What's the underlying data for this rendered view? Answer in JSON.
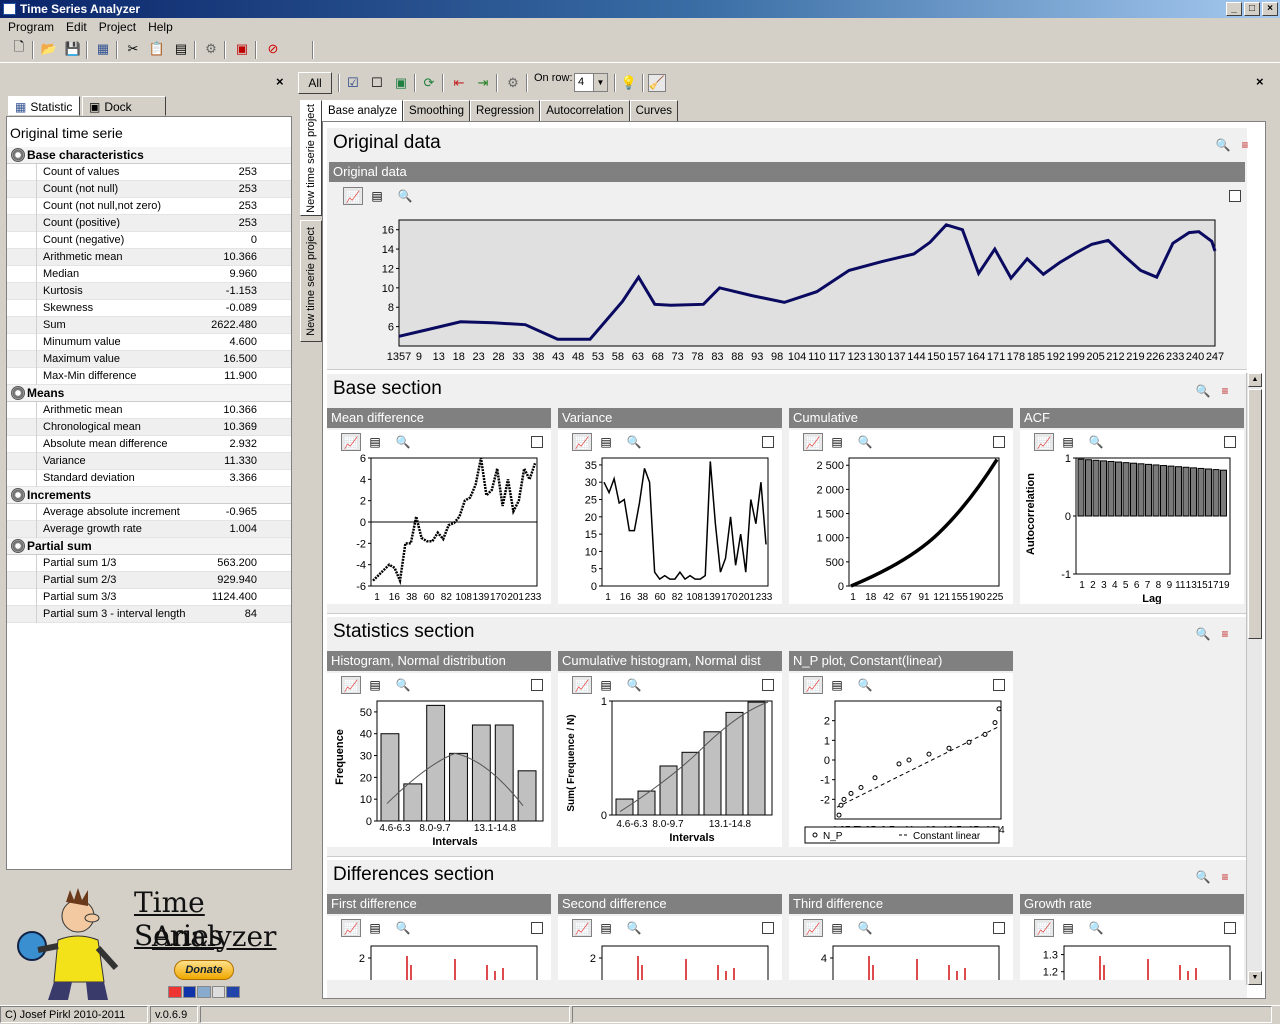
{
  "window": {
    "title": "Time Series Analyzer"
  },
  "menu": [
    "Program",
    "Edit",
    "Project",
    "Help"
  ],
  "toolbar2": {
    "all_label": "All",
    "on_row_label": "On row:",
    "on_row_value": "4"
  },
  "left_tabs": [
    "Statistic",
    "Dock stack"
  ],
  "statistic": {
    "title": "Original time serie",
    "sections": [
      {
        "name": "Base characteristics",
        "rows": [
          {
            "label": "Count of values",
            "value": "253"
          },
          {
            "label": "Count (not null)",
            "value": "253"
          },
          {
            "label": "Count (not null,not zero)",
            "value": "253"
          },
          {
            "label": "Count (positive)",
            "value": "253"
          },
          {
            "label": "Count (negative)",
            "value": "0"
          },
          {
            "label": "Arithmetic mean",
            "value": "10.366"
          },
          {
            "label": "Median",
            "value": "9.960"
          },
          {
            "label": "Kurtosis",
            "value": "-1.153"
          },
          {
            "label": "Skewness",
            "value": "-0.089"
          },
          {
            "label": "Sum",
            "value": "2622.480"
          },
          {
            "label": "Minumum value",
            "value": "4.600"
          },
          {
            "label": "Maximum value",
            "value": "16.500"
          },
          {
            "label": "Max-Min difference",
            "value": "11.900"
          }
        ]
      },
      {
        "name": "Means",
        "rows": [
          {
            "label": "Arithmetic mean",
            "value": "10.366"
          },
          {
            "label": "Chronological mean",
            "value": "10.369"
          },
          {
            "label": "Absolute mean difference",
            "value": "2.932"
          },
          {
            "label": "Variance",
            "value": "11.330"
          },
          {
            "label": "Standard deviation",
            "value": "3.366"
          }
        ]
      },
      {
        "name": "Increments",
        "rows": [
          {
            "label": "Average absolute increment",
            "value": "-0.965"
          },
          {
            "label": "Average growth rate",
            "value": "1.004"
          }
        ]
      },
      {
        "name": "Partial sum",
        "rows": [
          {
            "label": "Partial sum 1/3",
            "value": "563.200"
          },
          {
            "label": "Partial sum 2/3",
            "value": "929.940"
          },
          {
            "label": "Partial sum 3/3",
            "value": "1124.400"
          },
          {
            "label": "Partial sum 3 - interval length",
            "value": "84"
          }
        ]
      }
    ]
  },
  "logo": {
    "line1": "Time Series",
    "line2": "Analyzer",
    "donate": "Donate"
  },
  "vertical_tabs": [
    "New time serie project",
    "New time serie project"
  ],
  "analysis_tabs": [
    "Base analyze",
    "Smoothing",
    "Regression",
    "Autocorrelation",
    "Curves"
  ],
  "original": {
    "section_title": "Original data",
    "panel_title": "Original data"
  },
  "base_section": {
    "title": "Base section",
    "panels": [
      "Mean difference",
      "Variance",
      "Cumulative",
      "ACF"
    ]
  },
  "stats_section": {
    "title": "Statistics section",
    "panels": [
      "Histogram, Normal distribution",
      "Cumulative histogram, Normal dist",
      "N_P plot, Constant(linear)"
    ]
  },
  "diff_section": {
    "title": "Differences section",
    "panels": [
      "First difference",
      "Second difference",
      "Third difference",
      "Growth rate"
    ]
  },
  "chart_labels": {
    "acf_ylabel": "Autocorrelation",
    "acf_xlabel": "Lag",
    "hist_ylabel": "Frequence",
    "hist_xlabel": "Intervals",
    "cumhist_ylabel": "Sum( Frequence / N)",
    "cumhist_xlabel": "Intervals",
    "np_legend_1": "N_P",
    "np_legend_2": "Constant linear"
  },
  "chart_data": [
    {
      "type": "line",
      "title": "Original data",
      "ylim": [
        4,
        17
      ],
      "yticks": [
        6,
        8,
        10,
        12,
        14,
        16
      ],
      "xticklabels": [
        "1357",
        "9",
        "13",
        "18",
        "23",
        "28",
        "33",
        "38",
        "43",
        "48",
        "53",
        "58",
        "63",
        "68",
        "73",
        "78",
        "83",
        "88",
        "93",
        "98",
        "104",
        "110",
        "117",
        "123",
        "130",
        "137",
        "144",
        "150",
        "157",
        "164",
        "171",
        "178",
        "185",
        "192",
        "199",
        "205",
        "212",
        "219",
        "226",
        "233",
        "240",
        "247"
      ],
      "x": [
        1,
        10,
        20,
        30,
        40,
        50,
        60,
        70,
        75,
        80,
        85,
        95,
        100,
        110,
        120,
        130,
        140,
        150,
        160,
        165,
        170,
        175,
        180,
        185,
        190,
        195,
        200,
        205,
        210,
        215,
        220,
        225,
        230,
        235,
        240,
        245,
        248,
        252,
        253
      ],
      "y": [
        5,
        5.7,
        6.5,
        6.4,
        6.2,
        4.7,
        4.7,
        8.6,
        11.1,
        8.3,
        8.2,
        8.3,
        10,
        9.2,
        8.5,
        9.6,
        11.8,
        12.7,
        13.5,
        14.7,
        16.5,
        16,
        11.5,
        14,
        11,
        13,
        11.4,
        12.6,
        13.6,
        14.5,
        14.9,
        13.3,
        11.8,
        11.1,
        14.6,
        15.7,
        15.8,
        14.8,
        13.8
      ]
    },
    {
      "type": "line",
      "title": "Mean difference",
      "ylim": [
        -6,
        6
      ],
      "yticks": [
        -6,
        -4,
        -2,
        0,
        2,
        4,
        6
      ],
      "xticklabels": [
        "1",
        "16",
        "38",
        "60",
        "82",
        "108",
        "139",
        "170",
        "201",
        "233"
      ]
    },
    {
      "type": "line",
      "title": "Variance",
      "ylim": [
        0,
        37
      ],
      "yticks": [
        0,
        5,
        10,
        15,
        20,
        25,
        30,
        35
      ],
      "xticklabels": [
        "1",
        "16",
        "38",
        "60",
        "82",
        "108",
        "139",
        "170",
        "201",
        "233"
      ]
    },
    {
      "type": "line",
      "title": "Cumulative",
      "ylim": [
        0,
        2650
      ],
      "yticks": [
        0,
        500,
        1000,
        1500,
        2000,
        2500
      ],
      "yticklabels": [
        "0",
        "500",
        "1 000",
        "1 500",
        "2 000",
        "2 500"
      ],
      "xticklabels": [
        "1",
        "18",
        "42",
        "67",
        "91",
        "121",
        "155",
        "190",
        "225"
      ]
    },
    {
      "type": "bar",
      "title": "ACF",
      "ylim": [
        -1,
        1
      ],
      "yticks": [
        -1,
        0,
        1
      ],
      "xlabel": "Lag",
      "ylabel": "Autocorrelation",
      "xticklabels": [
        "1",
        "2",
        "3",
        "4",
        "5",
        "6",
        "7",
        "8",
        "9",
        "11",
        "13",
        "15",
        "17",
        "19"
      ],
      "values": [
        0.98,
        0.97,
        0.96,
        0.95,
        0.94,
        0.93,
        0.92,
        0.91,
        0.9,
        0.89,
        0.88,
        0.87,
        0.86,
        0.85,
        0.84,
        0.83,
        0.82,
        0.81,
        0.8,
        0.79
      ]
    },
    {
      "type": "bar",
      "title": "Histogram, Normal distribution",
      "ylim": [
        0,
        55
      ],
      "yticks": [
        0,
        10,
        20,
        30,
        40,
        50
      ],
      "xticklabels": [
        "4.6-6.3",
        "8.0-9.7",
        "13.1-14.8"
      ],
      "xlabel": "Intervals",
      "ylabel": "Frequence",
      "values": [
        40,
        17,
        53,
        31,
        44,
        44,
        23
      ]
    },
    {
      "type": "bar",
      "title": "Cumulative histogram, Normal dist",
      "ylim": [
        0,
        1
      ],
      "yticks": [
        0,
        1
      ],
      "xticklabels": [
        "4.6-6.3",
        "8.0-9.7",
        "13.1-14.8"
      ],
      "xlabel": "Intervals",
      "ylabel": "Sum( Frequence / N)",
      "values": [
        0.14,
        0.21,
        0.43,
        0.55,
        0.73,
        0.9,
        0.99
      ]
    },
    {
      "type": "scatter",
      "title": "N_P plot, Constant(linear)",
      "ylim": [
        -3,
        3
      ],
      "yticks": [
        -2,
        -1,
        0,
        1,
        2
      ],
      "xticklabels": [
        "4,65,7",
        "8,05",
        "9,7",
        "11",
        "12",
        "13,5",
        "15",
        "16,4"
      ]
    },
    {
      "type": "bar",
      "title": "First difference",
      "yticks": [
        2
      ],
      "ylim": [
        0,
        2.5
      ]
    },
    {
      "type": "bar",
      "title": "Second difference",
      "yticks": [
        2
      ],
      "ylim": [
        0,
        2.5
      ]
    },
    {
      "type": "bar",
      "title": "Third difference",
      "yticks": [
        4
      ],
      "ylim": [
        0,
        5
      ]
    },
    {
      "type": "bar",
      "title": "Growth rate",
      "yticks": [
        1.3,
        1.2
      ],
      "ylim": [
        1.0,
        1.35
      ]
    }
  ],
  "status": {
    "copyright": "C) Josef Pirkl 2010-2011",
    "version": "v.0.6.9"
  }
}
